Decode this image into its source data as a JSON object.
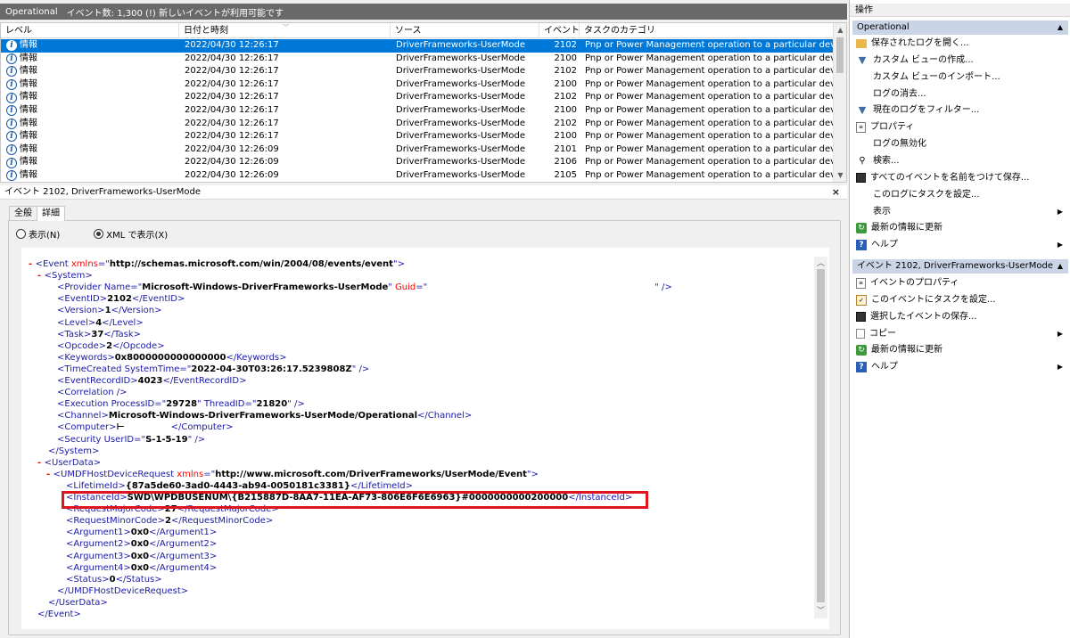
{
  "topbar": {
    "log_name": "Operational",
    "event_count_text": "イベント数: 1,300 (!) 新しいイベントが利用可能です"
  },
  "list": {
    "columns": [
      "レベル",
      "日付と時刻",
      "ソース",
      "イベント...",
      "タスクのカテゴリ"
    ],
    "rows": [
      {
        "level": "情報",
        "date": "2022/04/30 12:26:17",
        "source": "DriverFrameworks-UserMode",
        "id": "2102",
        "task": "Pnp or Power Management operation to a particular device."
      },
      {
        "level": "情報",
        "date": "2022/04/30 12:26:17",
        "source": "DriverFrameworks-UserMode",
        "id": "2100",
        "task": "Pnp or Power Management operation to a particular device."
      },
      {
        "level": "情報",
        "date": "2022/04/30 12:26:17",
        "source": "DriverFrameworks-UserMode",
        "id": "2102",
        "task": "Pnp or Power Management operation to a particular device."
      },
      {
        "level": "情報",
        "date": "2022/04/30 12:26:17",
        "source": "DriverFrameworks-UserMode",
        "id": "2100",
        "task": "Pnp or Power Management operation to a particular device."
      },
      {
        "level": "情報",
        "date": "2022/04/30 12:26:17",
        "source": "DriverFrameworks-UserMode",
        "id": "2102",
        "task": "Pnp or Power Management operation to a particular device."
      },
      {
        "level": "情報",
        "date": "2022/04/30 12:26:17",
        "source": "DriverFrameworks-UserMode",
        "id": "2100",
        "task": "Pnp or Power Management operation to a particular device."
      },
      {
        "level": "情報",
        "date": "2022/04/30 12:26:17",
        "source": "DriverFrameworks-UserMode",
        "id": "2102",
        "task": "Pnp or Power Management operation to a particular device."
      },
      {
        "level": "情報",
        "date": "2022/04/30 12:26:17",
        "source": "DriverFrameworks-UserMode",
        "id": "2100",
        "task": "Pnp or Power Management operation to a particular device."
      },
      {
        "level": "情報",
        "date": "2022/04/30 12:26:09",
        "source": "DriverFrameworks-UserMode",
        "id": "2101",
        "task": "Pnp or Power Management operation to a particular device."
      },
      {
        "level": "情報",
        "date": "2022/04/30 12:26:09",
        "source": "DriverFrameworks-UserMode",
        "id": "2106",
        "task": "Pnp or Power Management operation to a particular device."
      },
      {
        "level": "情報",
        "date": "2022/04/30 12:26:09",
        "source": "DriverFrameworks-UserMode",
        "id": "2105",
        "task": "Pnp or Power Management operation to a particular device."
      }
    ]
  },
  "detail": {
    "title": "イベント 2102, DriverFrameworks-UserMode",
    "close_glyph": "×",
    "tabs": [
      "全般",
      "詳細"
    ],
    "radio_friendly": "表示(N)",
    "radio_xml": "XML で表示(X)",
    "xml": {
      "event_ns": "http://schemas.microsoft.com/win/2004/08/events/event",
      "provider_name": "Microsoft-Windows-DriverFrameworks-UserMode",
      "event_id": "2102",
      "version": "1",
      "level": "4",
      "task": "37",
      "opcode": "2",
      "keywords": "0x8000000000000000",
      "system_time": "2022-04-30T03:26:17.5239808Z",
      "record_id": "4023",
      "process_id": "29728",
      "thread_id": "21820",
      "channel": "Microsoft-Windows-DriverFrameworks-UserMode/Operational",
      "computer_suffix": "⊢",
      "user_id": "S-1-5-19",
      "userdata_ns": "http://www.microsoft.com/DriverFrameworks/UserMode/Event",
      "lifetime_id": "{87a5de60-3ad0-4443-ab94-0050181c3381}",
      "instance_id": "SWD\\WPDBUSENUM\\{B215887D-8AA7-11EA-AF73-806E6F6E6963}#0000000000200000",
      "major_code": "27",
      "minor_code": "2",
      "arg1": "0x0",
      "arg2": "0x0",
      "arg3": "0x0",
      "arg4": "0x0",
      "status": "0"
    }
  },
  "actions": {
    "title": "操作",
    "section1_title": "Operational",
    "section1": [
      {
        "label": "保存されたログを開く...",
        "icon": "folder-open-icon"
      },
      {
        "label": "カスタム ビューの作成...",
        "icon": "filter-icon"
      },
      {
        "label": "カスタム ビューのインポート...",
        "icon": ""
      },
      {
        "label": "ログの消去...",
        "icon": ""
      },
      {
        "label": "現在のログをフィルター...",
        "icon": "filter-icon"
      },
      {
        "label": "プロパティ",
        "icon": "properties-icon"
      },
      {
        "label": "ログの無効化",
        "icon": ""
      },
      {
        "label": "検索...",
        "icon": "binoculars-icon"
      },
      {
        "label": "すべてのイベントを名前をつけて保存...",
        "icon": "save-icon"
      },
      {
        "label": "このログにタスクを設定...",
        "icon": ""
      },
      {
        "label": "表示",
        "icon": ""
      },
      {
        "label": "最新の情報に更新",
        "icon": "refresh-icon"
      },
      {
        "label": "ヘルプ",
        "icon": "help-icon"
      }
    ],
    "section2_title": "イベント 2102, DriverFrameworks-UserMode",
    "section2": [
      {
        "label": "イベントのプロパティ",
        "icon": "properties-icon"
      },
      {
        "label": "このイベントにタスクを設定...",
        "icon": "task-icon"
      },
      {
        "label": "選択したイベントの保存...",
        "icon": "save-icon"
      },
      {
        "label": "コピー",
        "icon": "copy-icon"
      },
      {
        "label": "最新の情報に更新",
        "icon": "refresh-icon"
      },
      {
        "label": "ヘルプ",
        "icon": "help-icon"
      }
    ]
  }
}
